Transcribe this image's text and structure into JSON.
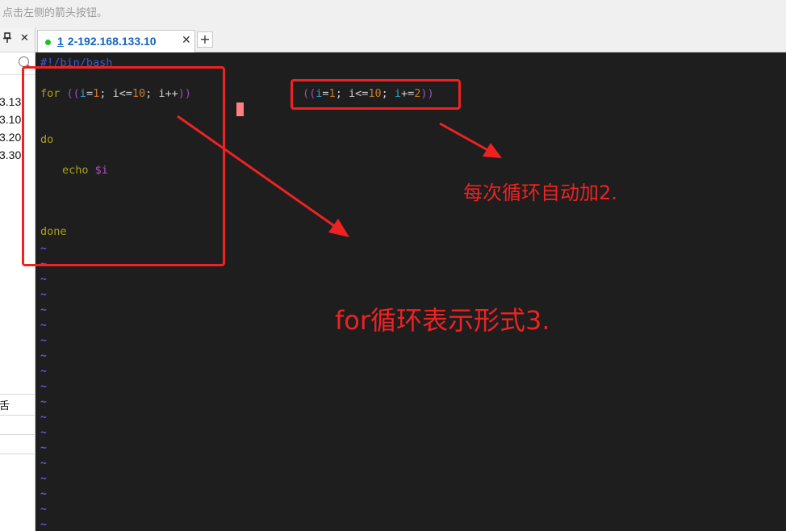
{
  "hint_bar": {
    "text": "点击左侧的箭头按钮。"
  },
  "left_panel": {
    "pin_icon": "pin-icon",
    "close_glyph": "✕",
    "search_icon": "search-icon",
    "items": [
      "3.13",
      "3.10",
      "3.20",
      "3.30"
    ],
    "bottom_label": "舌"
  },
  "tabs": [
    {
      "status_color": "#1fbf1f",
      "number": "1",
      "title": "2-192.168.133.10",
      "close_glyph": "✕"
    }
  ],
  "new_tab_glyph": "+",
  "editor": {
    "shebang": "#!/bin/bash",
    "for_keyword": "for",
    "loop_open": "((",
    "loop_var1": "i",
    "loop_eq1": "=",
    "loop_start": "1",
    "loop_sep1": "; i<=",
    "loop_end": "10",
    "loop_sep2": "; i++",
    "loop_close": "))",
    "do_keyword": "do",
    "echo_keyword": "echo",
    "echo_var": "$i",
    "done_keyword": "done",
    "tilde": "~",
    "alt_open": "((",
    "alt_var1": "i",
    "alt_eq1": "=",
    "alt_start": "1",
    "alt_sep1": "; i<=",
    "alt_end": "10",
    "alt_sep2": "; ",
    "alt_var2": "i",
    "alt_plus": "+=",
    "alt_step": "2",
    "alt_close": "))"
  },
  "annotations": {
    "step_note": "每次循环自动加2.",
    "form_note": "for循环表示形式3."
  },
  "colors": {
    "annotation_red": "#ee2222",
    "terminal_bg": "#1e1e1e",
    "tab_title_blue": "#1565c0"
  }
}
